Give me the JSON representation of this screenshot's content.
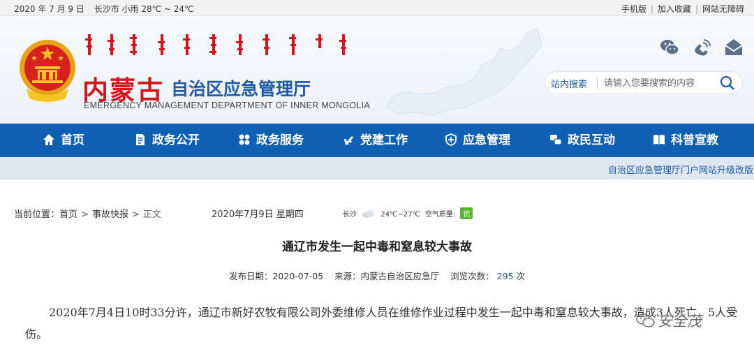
{
  "topbar": {
    "date": "2020 年 7 月 9 日",
    "weather": "长沙市 小雨 28℃ ~ 24℃",
    "links": [
      "手机版",
      "加入收藏",
      "网站无障碍"
    ]
  },
  "header": {
    "logo_red": "内蒙古",
    "logo_blue": "自治区应急管理厅",
    "logo_en": "EMERGENCY MANAGEMENT DEPARTMENT OF INNER MONGOLIA"
  },
  "search": {
    "label": "站内搜索",
    "placeholder": "请输入您要搜索的内容"
  },
  "nav": {
    "items": [
      "首页",
      "政务公开",
      "政务服务",
      "党建工作",
      "应急管理",
      "政民互动",
      "科普宣教"
    ]
  },
  "ticker": {
    "message": "自治区应急管理厅门户网站升级改版"
  },
  "breadcrumb": {
    "prefix": "当前位置：",
    "home": "首页",
    "section": "事故快报",
    "current": "正文"
  },
  "date_line": "2020年7月9日 星期四",
  "weather_widget": {
    "city": "长沙",
    "temp": "24℃~27℃",
    "aq_label": "空气质量:",
    "aq_value": "优"
  },
  "article": {
    "title": "通辽市发生一起中毒和窒息较大事故",
    "pub_label": "发布日期：",
    "pub_date": "2020-07-05",
    "source_label": "来源：",
    "source": "内蒙古自治区应急厅",
    "views_label": "浏览次数：",
    "views": "295",
    "views_unit": "次",
    "body": "2020年7月4日10时33分许，通辽市新好农牧有限公司外委维修人员在维修作业过程中发生一起中毒和窒息较大事故，造成3人死亡，5人受伤。"
  },
  "watermark": "安全茂",
  "colors": {
    "nav_bg": "#0f5fb3",
    "logo_red": "#d4151c",
    "logo_blue": "#1e5aa8",
    "aq_green": "#5cb531"
  }
}
